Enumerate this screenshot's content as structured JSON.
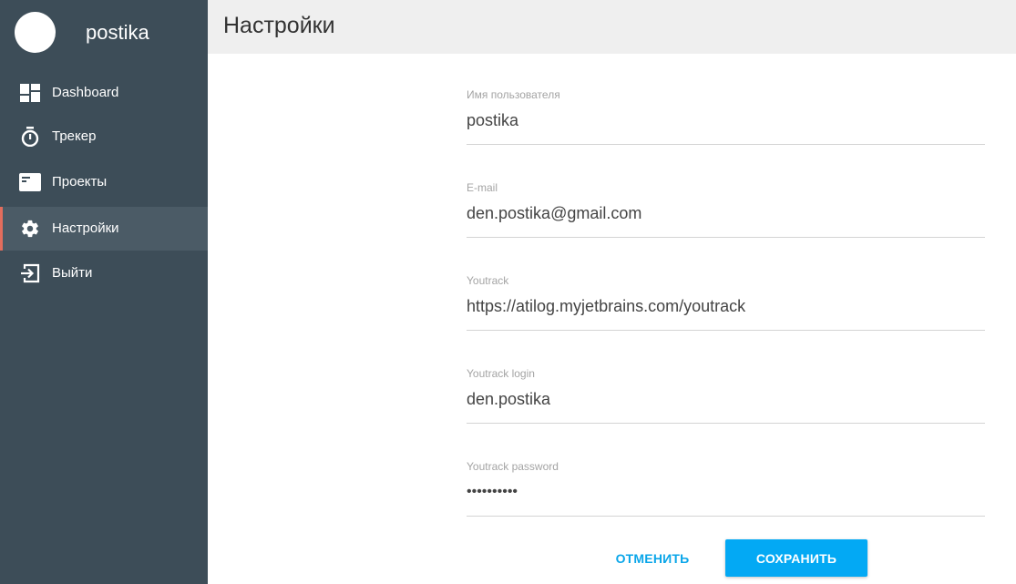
{
  "profile": {
    "name": "postika"
  },
  "sidebar": {
    "items": [
      {
        "label": "Dashboard",
        "icon": "dashboard-icon"
      },
      {
        "label": "Трекер",
        "icon": "stopwatch-icon"
      },
      {
        "label": "Проекты",
        "icon": "projects-icon"
      },
      {
        "label": "Настройки",
        "icon": "gear-icon",
        "active": true
      },
      {
        "label": "Выйти",
        "icon": "exit-icon"
      }
    ]
  },
  "header": {
    "title": "Настройки"
  },
  "form": {
    "username": {
      "label": "Имя пользователя",
      "value": "postika"
    },
    "email": {
      "label": "E-mail",
      "value": "den.postika@gmail.com"
    },
    "youtrack": {
      "label": "Youtrack",
      "value": "https://atilog.myjetbrains.com/youtrack"
    },
    "youtrack_login": {
      "label": "Youtrack login",
      "value": "den.postika"
    },
    "youtrack_password": {
      "label": "Youtrack password",
      "value": "••••••••••"
    }
  },
  "actions": {
    "cancel_label": "ОТМЕНИТЬ",
    "save_label": "СОХРАНИТЬ"
  },
  "colors": {
    "sidebar_bg": "#3d4d58",
    "active_item_bg": "#4b5b66",
    "active_marker": "#e36d5d",
    "accent": "#03a9f4",
    "header_bg": "#efefef"
  }
}
